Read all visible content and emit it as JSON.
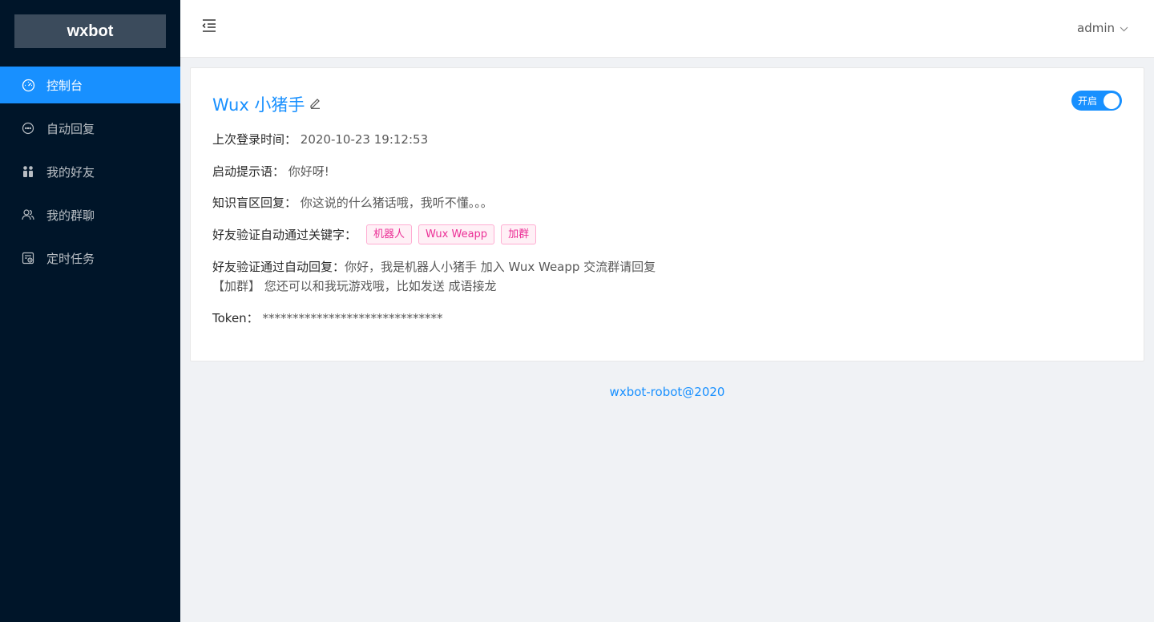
{
  "sidebar": {
    "logo": "wxbot",
    "items": [
      {
        "label": "控制台",
        "icon": "dashboard-icon"
      },
      {
        "label": "自动回复",
        "icon": "message-icon"
      },
      {
        "label": "我的好友",
        "icon": "friends-icon"
      },
      {
        "label": "我的群聊",
        "icon": "group-icon"
      },
      {
        "label": "定时任务",
        "icon": "schedule-icon"
      }
    ],
    "active_index": 0
  },
  "header": {
    "username": "admin"
  },
  "card": {
    "title": "Wux 小猪手",
    "switch_label": "开启",
    "switch_on": true,
    "last_login_label": "上次登录时间：",
    "last_login_value": "2020-10-23 19:12:53",
    "start_hint_label": "启动提示语：",
    "start_hint_value": "你好呀!",
    "blind_reply_label": "知识盲区回复：",
    "blind_reply_value": "你这说的什么猪话哦，我听不懂。。。",
    "keywords_label": "好友验证自动通过关键字：",
    "keywords": [
      "机器人",
      "Wux Weapp",
      "加群"
    ],
    "friend_reply_label": "好友验证通过自动回复：",
    "friend_reply_value": "你好，我是机器人小猪手 加入 Wux Weapp 交流群请回复【加群】 您还可以和我玩游戏哦，比如发送 成语接龙",
    "token_label": "Token：",
    "token_value": "******************************"
  },
  "footer": {
    "text": "wxbot-robot@2020"
  },
  "colors": {
    "primary": "#1890ff",
    "sider_bg": "#001529",
    "tag_text": "#eb2f96"
  }
}
